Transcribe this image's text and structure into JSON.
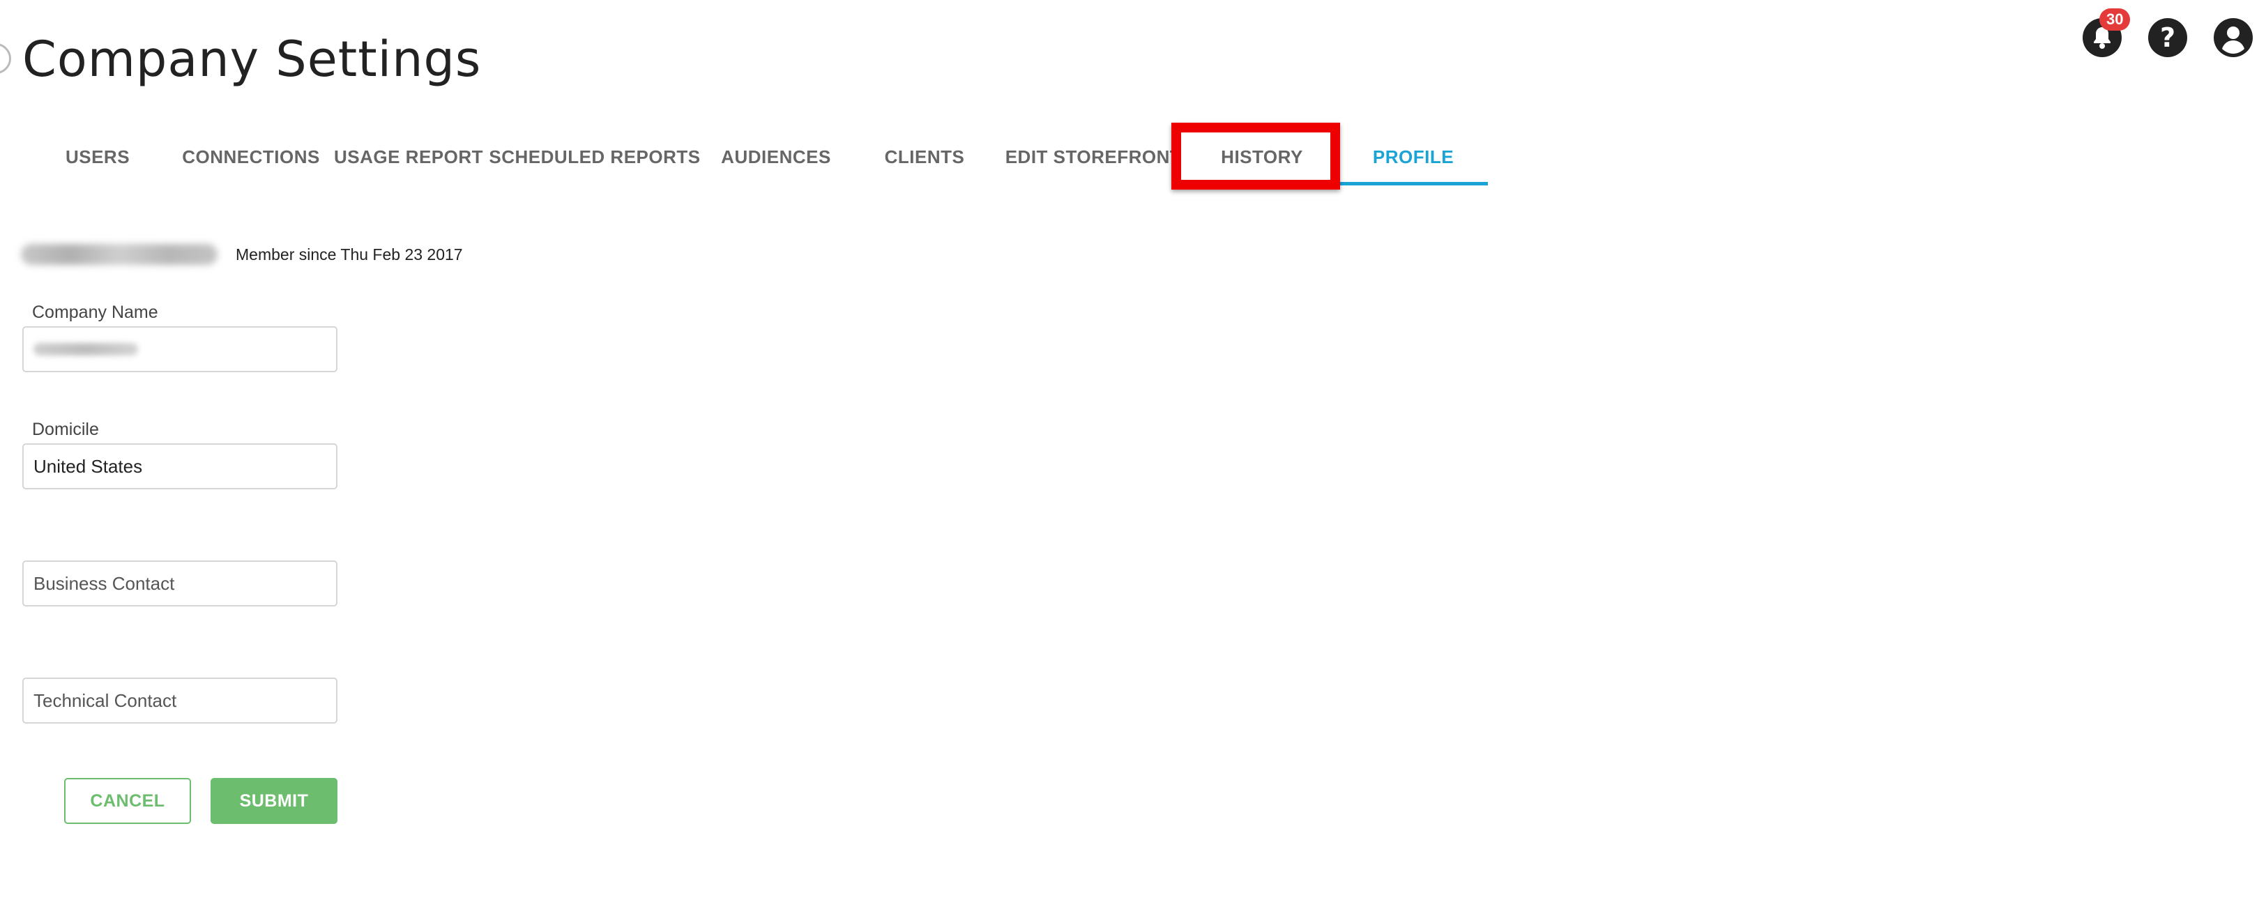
{
  "header": {
    "title": "Company Settings",
    "notification_count": "30",
    "help_glyph": "?"
  },
  "tabs": [
    {
      "label": "USERS"
    },
    {
      "label": "CONNECTIONS"
    },
    {
      "label": "USAGE REPORT"
    },
    {
      "label": "SCHEDULED REPORTS"
    },
    {
      "label": "AUDIENCES"
    },
    {
      "label": "CLIENTS"
    },
    {
      "label": "EDIT STOREFRONT"
    },
    {
      "label": "HISTORY"
    },
    {
      "label": "PROFILE"
    }
  ],
  "active_tab": "PROFILE",
  "highlighted_tab": "HISTORY",
  "company": {
    "member_since": "Member since Thu Feb 23 2017"
  },
  "form": {
    "company_name_label": "Company Name",
    "domicile_label": "Domicile",
    "domicile_value": "United States",
    "business_contact_placeholder": "Business Contact",
    "technical_contact_placeholder": "Technical Contact",
    "cancel_label": "CANCEL",
    "submit_label": "SUBMIT"
  },
  "colors": {
    "accent": "#1aa4d6",
    "highlight": "#ee0000",
    "button_green": "#6cbd6e",
    "badge_red": "#e43a3a"
  },
  "icons": [
    "bell-icon",
    "help-icon",
    "account-icon",
    "back-icon"
  ]
}
